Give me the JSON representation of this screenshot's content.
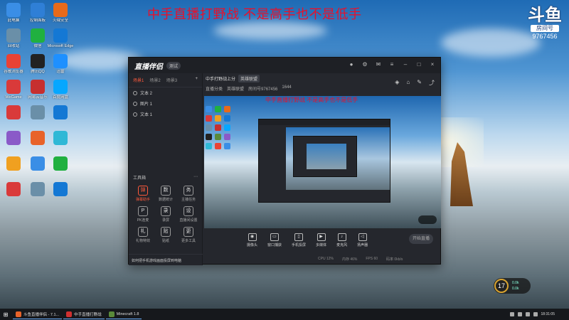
{
  "overlay_title": "中手直播打野战 不是高手也不是低手",
  "stream_logo": {
    "mark": "斗鱼",
    "sub": "房间号",
    "room_number": "9767456"
  },
  "desktop_icons": [
    {
      "label": "此电脑",
      "color": "#3a8ee6"
    },
    {
      "label": "控制面板",
      "color": "#2f7fd6"
    },
    {
      "label": "火绒安全",
      "color": "#e86a1a"
    },
    {
      "label": "回收站",
      "color": "#6a8fa8"
    },
    {
      "label": "微信",
      "color": "#20b040"
    },
    {
      "label": "Microsoft Edge",
      "color": "#1478d4"
    },
    {
      "label": "谷歌浏览器",
      "color": "#e94235"
    },
    {
      "label": "腾讯QQ",
      "color": "#222"
    },
    {
      "label": "迅雷",
      "color": "#1e90ff"
    },
    {
      "label": "WeGame",
      "color": "#d93a3a"
    },
    {
      "label": "网易云音乐",
      "color": "#c62f2f"
    },
    {
      "label": "百度网盘",
      "color": "#06a7ff"
    }
  ],
  "app": {
    "name": "直播伴侣",
    "version": "测试",
    "left_tabs": [
      "场景1",
      "场景2",
      "场景3"
    ],
    "sources": [
      "文本 2",
      "图片 1",
      "文本 1"
    ],
    "tools_title": "工具箱",
    "tools": [
      {
        "label": "弹幕助手",
        "icon": "弹",
        "hot": true
      },
      {
        "label": "数据统计",
        "icon": "数",
        "hot": false
      },
      {
        "label": "主播任务",
        "icon": "务",
        "hot": false
      },
      {
        "label": "PK连麦",
        "icon": "P",
        "hot": false
      },
      {
        "label": "录屏",
        "icon": "录",
        "hot": false
      },
      {
        "label": "直播间设置",
        "icon": "设",
        "hot": false
      },
      {
        "label": "礼物特效",
        "icon": "礼",
        "hot": false
      },
      {
        "label": "贴纸",
        "icon": "贴",
        "hot": false
      },
      {
        "label": "更多工具",
        "icon": "更",
        "hot": false
      }
    ],
    "bottom_tip": "如何把手机游戏画面投屏到电脑",
    "room_title": "中手打野战上分",
    "room_tag": "英雄联盟",
    "room_meta": [
      "直播分类",
      "英雄联盟",
      "房间号9767456",
      "1644"
    ],
    "preview_title": "中手直播打野战 不是高手也不是低手",
    "toolbar": [
      "摄像头",
      "窗口捕获",
      "手机投屏",
      "多媒体",
      "麦克风",
      "扬声器"
    ],
    "start_button": "开始直播",
    "status": [
      "CPU 12%",
      "内存 46%",
      "FPS 60",
      "码率 0kb/s"
    ]
  },
  "widget": {
    "level": "17",
    "line1": "0.0k",
    "line2": "0.0k"
  },
  "taskbar": {
    "tasks": [
      {
        "label": "斗鱼直播伴侣 - 7.1...",
        "color": "#e8632a"
      },
      {
        "label": "中手直播打野战",
        "color": "#d03030"
      },
      {
        "label": "Minecraft 1.8",
        "color": "#5a8a3a"
      }
    ],
    "clock": "18:31:05"
  }
}
